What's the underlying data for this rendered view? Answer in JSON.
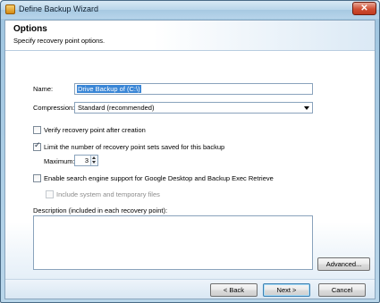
{
  "window": {
    "title": "Define Backup Wizard",
    "close_glyph": "✕"
  },
  "header": {
    "title": "Options",
    "subtitle": "Specify recovery point options."
  },
  "form": {
    "name_label": "Name:",
    "name_value": "Drive Backup of (C:\\)",
    "compression_label": "Compression:",
    "compression_value": "Standard (recommended)",
    "verify_label": "Verify recovery point after creation",
    "verify_checked": false,
    "limit_label": "Limit the number of recovery point sets saved for this backup",
    "limit_checked": true,
    "maximum_label": "Maximum:",
    "maximum_value": "3",
    "search_label": "Enable search engine support for Google Desktop and Backup Exec Retrieve",
    "search_checked": false,
    "include_label": "Include system and temporary files",
    "include_checked": false,
    "include_enabled": false,
    "description_label": "Description (included in each recovery point):",
    "description_value": ""
  },
  "buttons": {
    "advanced": "Advanced...",
    "back": "< Back",
    "next": "Next >",
    "cancel": "Cancel"
  }
}
